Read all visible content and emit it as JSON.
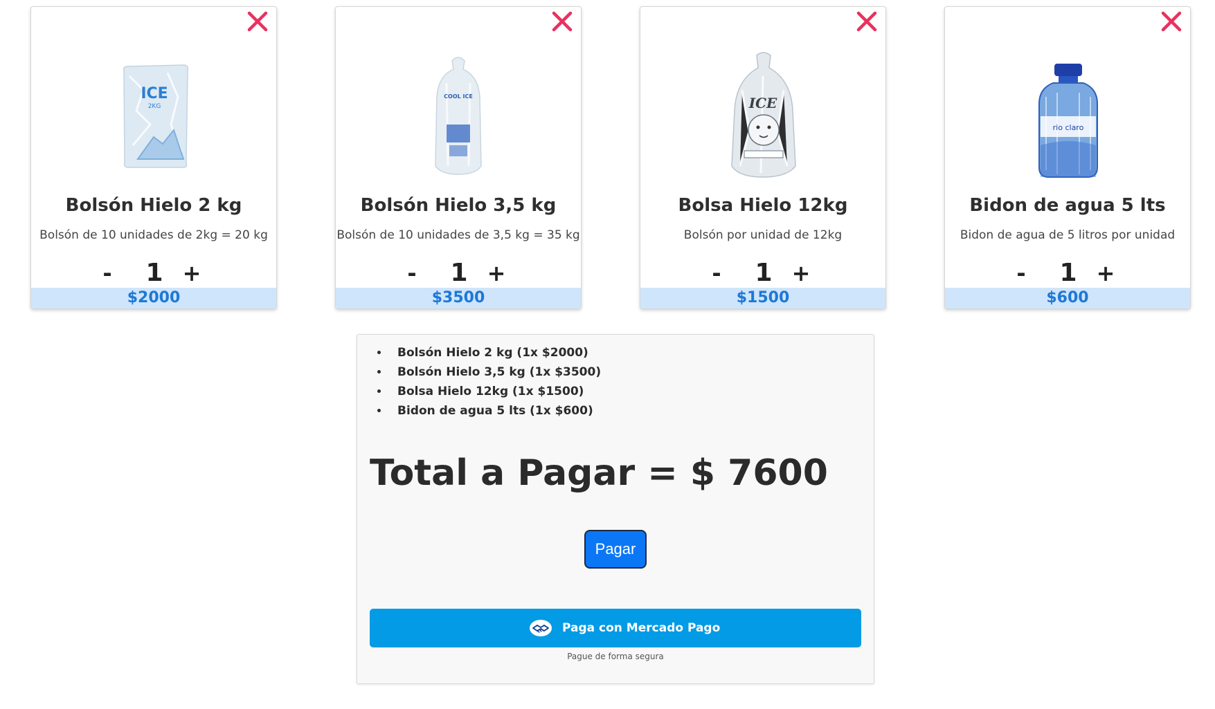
{
  "products": [
    {
      "name": "Bolsón Hielo 2 kg",
      "description": "Bolsón de 10 unidades de 2kg = 20 kg",
      "quantity": "1",
      "minus": "-",
      "plus": "+",
      "price": "$2000",
      "image_icon": "ice-bag-2kg-icon",
      "image_text": "ICE",
      "image_subtext": "2KG"
    },
    {
      "name": "Bolsón Hielo 3,5 kg",
      "description": "Bolsón de 10 unidades de 3,5 kg = 35 kg",
      "quantity": "1",
      "minus": "-",
      "plus": "+",
      "price": "$3500",
      "image_icon": "ice-bag-3-5kg-icon",
      "image_text": "COOL ICE"
    },
    {
      "name": "Bolsa Hielo 12kg",
      "description": "Bolsón por unidad de 12kg",
      "quantity": "1",
      "minus": "-",
      "plus": "+",
      "price": "$1500",
      "image_icon": "ice-bag-12kg-icon",
      "image_text": "ICE"
    },
    {
      "name": "Bidon de agua 5 lts",
      "description": "Bidon de agua de 5 litros por unidad",
      "quantity": "1",
      "minus": "-",
      "plus": "+",
      "price": "$600",
      "image_icon": "water-jug-icon",
      "image_text": "rio claro"
    }
  ],
  "summary": {
    "items": [
      "Bolsón Hielo 2 kg (1x $2000)",
      "Bolsón Hielo 3,5 kg (1x $3500)",
      "Bolsa Hielo 12kg (1x $1500)",
      "Bidon de agua 5 lts (1x $600)"
    ],
    "total_label": "Total a Pagar = $ 7600",
    "pay_label": "Pagar",
    "mercado_pago_label": "Paga con Mercado Pago",
    "secure_note": "Pague de forma segura"
  },
  "colors": {
    "remove_icon": "#e8315f",
    "price_bg": "#cfe5fb",
    "price_text": "#1d78d6",
    "pay_button": "#0b77f5",
    "mercado_pago": "#039be5"
  },
  "icons": {
    "remove": "close-icon",
    "mercado_pago": "handshake-icon"
  }
}
